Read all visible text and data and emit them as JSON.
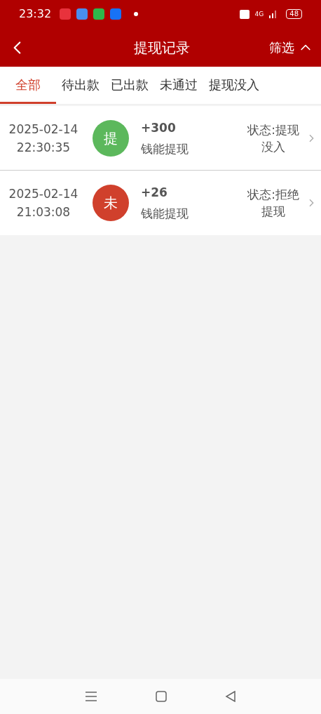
{
  "status_bar": {
    "time": "23:32",
    "network": "4G",
    "battery": "48"
  },
  "header": {
    "title": "提现记录",
    "filter": "筛选"
  },
  "tabs": [
    {
      "label": "全部",
      "selected": true
    },
    {
      "label": "待出款",
      "selected": false
    },
    {
      "label": "已出款",
      "selected": false
    },
    {
      "label": "未通过",
      "selected": false
    },
    {
      "label": "提现没入",
      "selected": false
    }
  ],
  "records": [
    {
      "date": "2025-02-14",
      "time": "22:30:35",
      "badge": "提",
      "color": "#5cb85c",
      "amount": "+300",
      "type": "钱能提现",
      "status": "状态:提现没入"
    },
    {
      "date": "2025-02-14",
      "time": "21:03:08",
      "badge": "未",
      "color": "#d0402c",
      "amount": "+26",
      "type": "钱能提现",
      "status": "状态:拒绝提现"
    }
  ]
}
